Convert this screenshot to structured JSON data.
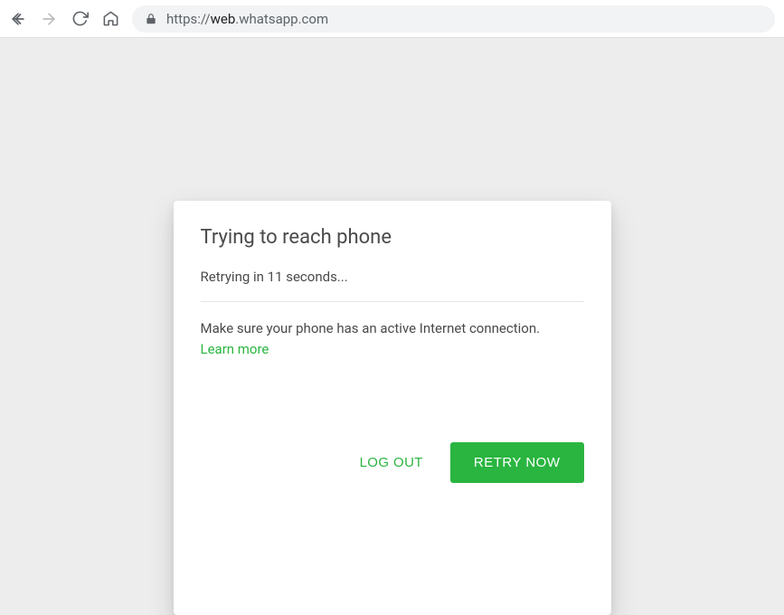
{
  "browser": {
    "url_prefix": "https://",
    "url_domain": "web",
    "url_rest": ".whatsapp.com"
  },
  "modal": {
    "title": "Trying to reach phone",
    "status": "Retrying in 11 seconds...",
    "message": "Make sure your phone has an active Internet connection. ",
    "learn_more": "Learn more",
    "logout_label": "LOG OUT",
    "retry_label": "RETRY NOW"
  },
  "colors": {
    "accent": "#2ab540",
    "page_bg": "#ededed"
  }
}
